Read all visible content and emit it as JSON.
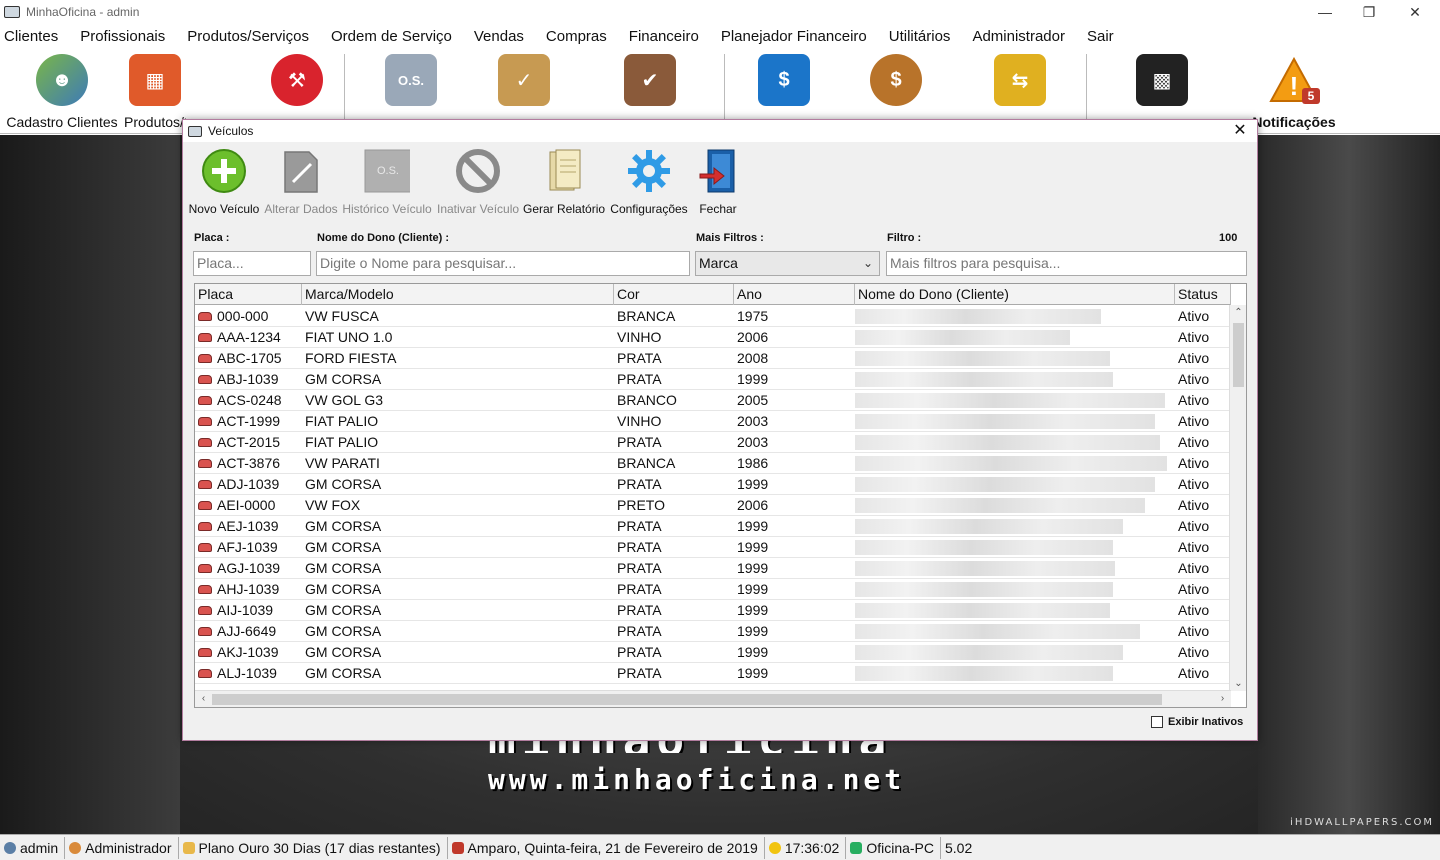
{
  "window": {
    "title": "MinhaOficina - admin"
  },
  "menu": [
    "Clientes",
    "Profissionais",
    "Produtos/Serviços",
    "Ordem de Serviço",
    "Vendas",
    "Compras",
    "Financeiro",
    "Planejador Financeiro",
    "Utilitários",
    "Administrador",
    "Sair"
  ],
  "toolbar": {
    "cadastro_clientes": "Cadastro Clientes",
    "produtos": "Produtos/Serviços",
    "notificacoes": "Notificações",
    "notif_count": "5"
  },
  "dialog": {
    "title": "Veículos",
    "tools": {
      "novo": "Novo Veículo",
      "alterar": "Alterar Dados",
      "historico": "Histórico Veículo",
      "inativar": "Inativar Veículo",
      "relatorio": "Gerar Relatório",
      "config": "Configurações",
      "fechar": "Fechar"
    },
    "filters": {
      "placa_label": "Placa :",
      "placa_placeholder": "Placa...",
      "dono_label": "Nome do Dono (Cliente) :",
      "dono_placeholder": "Digite o Nome para pesquisar...",
      "mais_label": "Mais Filtros :",
      "mais_value": "Marca",
      "filtro_label": "Filtro :",
      "filtro_placeholder": "Mais filtros para pesquisa...",
      "count": "100"
    },
    "columns": [
      "Placa",
      "Marca/Modelo",
      "Cor",
      "Ano",
      "Nome do Dono (Cliente)",
      "Status"
    ],
    "rows": [
      [
        "000-000",
        "VW FUSCA",
        "BRANCA",
        "1975",
        "Ativo"
      ],
      [
        "AAA-1234",
        "FIAT UNO 1.0",
        "VINHO",
        "2006",
        "Ativo"
      ],
      [
        "ABC-1705",
        "FORD FIESTA",
        "PRATA",
        "2008",
        "Ativo"
      ],
      [
        "ABJ-1039",
        "GM CORSA",
        "PRATA",
        "1999",
        "Ativo"
      ],
      [
        "ACS-0248",
        "VW GOL G3",
        "BRANCO",
        "2005",
        "Ativo"
      ],
      [
        "ACT-1999",
        "FIAT PALIO",
        "VINHO",
        "2003",
        "Ativo"
      ],
      [
        "ACT-2015",
        "FIAT PALIO",
        "PRATA",
        "2003",
        "Ativo"
      ],
      [
        "ACT-3876",
        "VW PARATI",
        "BRANCA",
        "1986",
        "Ativo"
      ],
      [
        "ADJ-1039",
        "GM CORSA",
        "PRATA",
        "1999",
        "Ativo"
      ],
      [
        "AEI-0000",
        "VW FOX",
        "PRETO",
        "2006",
        "Ativo"
      ],
      [
        "AEJ-1039",
        "GM CORSA",
        "PRATA",
        "1999",
        "Ativo"
      ],
      [
        "AFJ-1039",
        "GM CORSA",
        "PRATA",
        "1999",
        "Ativo"
      ],
      [
        "AGJ-1039",
        "GM CORSA",
        "PRATA",
        "1999",
        "Ativo"
      ],
      [
        "AHJ-1039",
        "GM CORSA",
        "PRATA",
        "1999",
        "Ativo"
      ],
      [
        "AIJ-1039",
        "GM CORSA",
        "PRATA",
        "1999",
        "Ativo"
      ],
      [
        "AJJ-6649",
        "GM CORSA",
        "PRATA",
        "1999",
        "Ativo"
      ],
      [
        "AKJ-1039",
        "GM CORSA",
        "PRATA",
        "1999",
        "Ativo"
      ],
      [
        "ALJ-1039",
        "GM CORSA",
        "PRATA",
        "1999",
        "Ativo"
      ]
    ],
    "exibir_inativos": "Exibir Inativos"
  },
  "background": {
    "brand_line1": "minhaoficina",
    "brand_line2": "www.minhaoficina.net",
    "watermark": "iHDWALLPAPERS.COM"
  },
  "status": {
    "user": "admin",
    "role": "Administrador",
    "plan": "Plano Ouro 30 Dias (17 dias restantes)",
    "date": "Amparo, Quinta-feira, 21 de Fevereiro de 2019",
    "time": "17:36:02",
    "pc": "Oficina-PC",
    "version": "5.02"
  }
}
